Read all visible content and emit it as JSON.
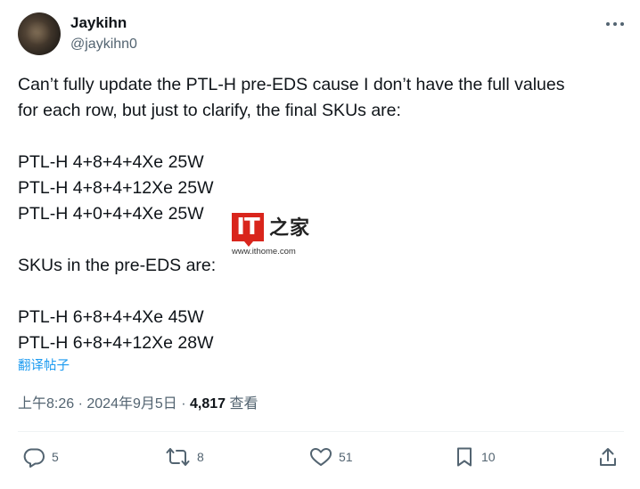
{
  "author": {
    "display_name": "Jaykihn",
    "handle": "@jaykihn0"
  },
  "post": {
    "lines": [
      "Can’t fully update the PTL-H pre-EDS cause I don’t have the full values",
      "for each row, but just to clarify, the final SKUs are:",
      "",
      "PTL-H 4+8+4+4Xe 25W",
      "PTL-H 4+8+4+12Xe 25W",
      "PTL-H 4+0+4+4Xe 25W",
      "",
      "SKUs in the pre-EDS are:",
      "",
      "PTL-H 6+8+4+4Xe 45W",
      "PTL-H 6+8+4+12Xe 28W"
    ],
    "translate_label": "翻译帖子"
  },
  "watermark": {
    "logo_text": "IT",
    "chars": "之家",
    "url": "www.ithome.com"
  },
  "meta": {
    "time": "上午8:26",
    "separator1": " · ",
    "date": "2024年9月5日",
    "separator2": " · ",
    "views_count": "4,817",
    "views_label": " 查看"
  },
  "actions": {
    "replies": "5",
    "reposts": "8",
    "likes": "51",
    "bookmarks": "10"
  },
  "icons": {
    "more": "more-dots-icon",
    "reply": "reply-bubble-icon",
    "repost": "repost-arrows-icon",
    "like": "heart-icon",
    "bookmark": "bookmark-icon",
    "share": "share-upload-icon"
  },
  "colors": {
    "text": "#0f1419",
    "secondary": "#536471",
    "link": "#1d9bf0",
    "watermark_red": "#d9251c"
  }
}
